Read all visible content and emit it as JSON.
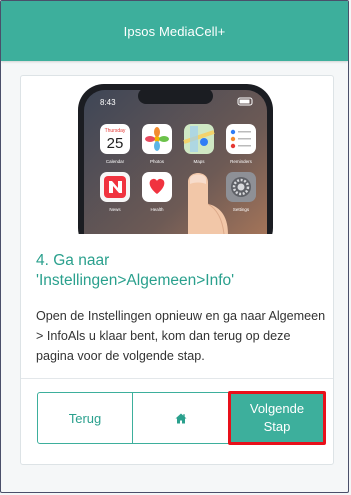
{
  "header": {
    "title": "Ipsos MediaCell+"
  },
  "phone": {
    "time": "8:43",
    "apps": [
      {
        "label": "Calendar",
        "day_name": "Thursday",
        "day_num": "25"
      },
      {
        "label": "Photos"
      },
      {
        "label": "Maps"
      },
      {
        "label": "Reminders"
      },
      {
        "label": "News"
      },
      {
        "label": "Health"
      },
      {
        "label": ""
      },
      {
        "label": "Settings"
      }
    ]
  },
  "step": {
    "title_line1": "4. Ga naar",
    "title_line2": "'Instellingen>Algemeen>Info'",
    "body": "Open de Instellingen opnieuw en ga naar Algemeen > InfoAls u klaar bent, kom dan terug op deze pagina voor de volgende stap."
  },
  "buttons": {
    "back_label": "Terug",
    "home_icon": "home-icon",
    "next_line1": "Volgende",
    "next_line2": "Stap"
  },
  "colors": {
    "accent": "#3daf9c",
    "highlight": "#e8101a"
  }
}
